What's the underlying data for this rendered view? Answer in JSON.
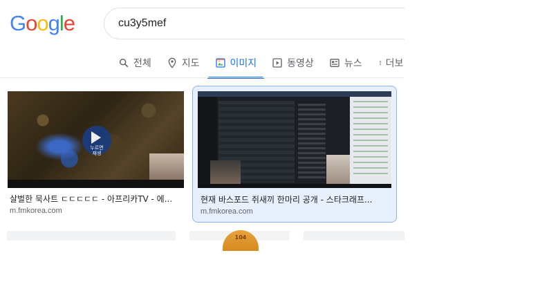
{
  "logo": {
    "letters": [
      "G",
      "o",
      "o",
      "g",
      "l",
      "e"
    ],
    "colors": [
      "#4285F4",
      "#EA4335",
      "#FBBC05",
      "#4285F4",
      "#34A853",
      "#EA4335"
    ]
  },
  "search": {
    "query": "cu3y5mef"
  },
  "tabs": [
    {
      "label": "전체",
      "icon": "search-icon"
    },
    {
      "label": "지도",
      "icon": "map-pin-icon"
    },
    {
      "label": "이미지",
      "icon": "image-icon",
      "active": true
    },
    {
      "label": "동영상",
      "icon": "video-icon"
    },
    {
      "label": "뉴스",
      "icon": "news-icon"
    },
    {
      "label": "더보",
      "icon": "more-dots-icon"
    }
  ],
  "accent_color": "#1a73e8",
  "results": [
    {
      "caption": "살벌한 묵사트 ㄷㄷㄷㄷㄷ - 아프리카TV - 에...",
      "source": "m.fmkorea.com",
      "thumb_overlay": "누르면\n재생"
    },
    {
      "caption": "현재 바스포드 쥐새끼 한마리 공개 - 스타크래프...",
      "source": "m.fmkorea.com",
      "selected": true
    }
  ],
  "bottom_partial_text": "104"
}
